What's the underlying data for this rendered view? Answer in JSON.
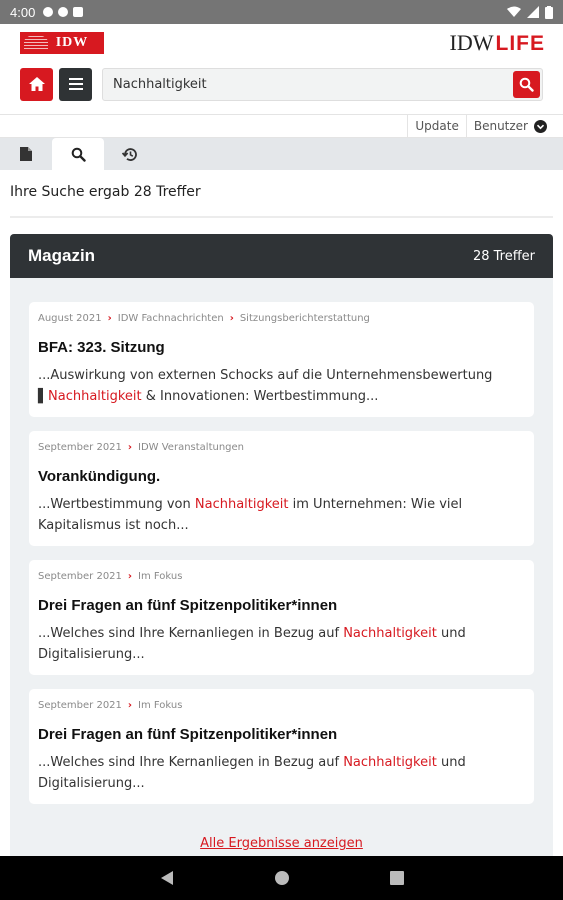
{
  "status_bar": {
    "time": "4:00"
  },
  "header": {
    "logo_text": "IDW",
    "brand_prefix": "IDW",
    "brand_suffix": "LIFE"
  },
  "search": {
    "value": "Nachhaltigkeit"
  },
  "user_bar": {
    "update_label": "Update",
    "user_label": "Benutzer"
  },
  "tabs": [
    {
      "icon": "document-icon",
      "active": false
    },
    {
      "icon": "search-icon",
      "active": true
    },
    {
      "icon": "history-icon",
      "active": false
    }
  ],
  "results": {
    "summary": "Ihre Suche ergab 28 Treffer",
    "section_title": "Magazin",
    "section_hits": "28 Treffer",
    "items": [
      {
        "crumbs": [
          "August 2021",
          "IDW Fachnachrichten",
          "Sitzungsberichterstattung"
        ],
        "title": "BFA: 323. Sitzung",
        "snippet_before": "...Auswirkung von externen Schocks auf die Unternehmensbewertung ▌",
        "highlight": "Nachhaltigkeit",
        "snippet_after": " & Innovationen: Wertbestimmung..."
      },
      {
        "crumbs": [
          "September 2021",
          "IDW Veranstaltungen"
        ],
        "title": "Vorankündigung.",
        "snippet_before": "...Wertbestimmung von ",
        "highlight": "Nachhaltigkeit",
        "snippet_after": " im Unternehmen: Wie viel Kapitalismus ist noch..."
      },
      {
        "crumbs": [
          "September 2021",
          "Im Fokus"
        ],
        "title": "Drei Fragen an fünf Spitzenpolitiker*innen",
        "snippet_before": "...Welches sind Ihre Kernanliegen in Bezug auf ",
        "highlight": "Nachhaltigkeit",
        "snippet_after": " und Digitalisierung..."
      },
      {
        "crumbs": [
          "September 2021",
          "Im Fokus"
        ],
        "title": "Drei Fragen an fünf Spitzenpolitiker*innen",
        "snippet_before": "...Welches sind Ihre Kernanliegen in Bezug auf ",
        "highlight": "Nachhaltigkeit",
        "snippet_after": " und Digitalisierung..."
      }
    ],
    "show_all_label": "Alle Ergebnisse anzeigen"
  },
  "colors": {
    "accent": "#d71920",
    "dark": "#2f3336",
    "panel_bg": "#eef1f3"
  }
}
